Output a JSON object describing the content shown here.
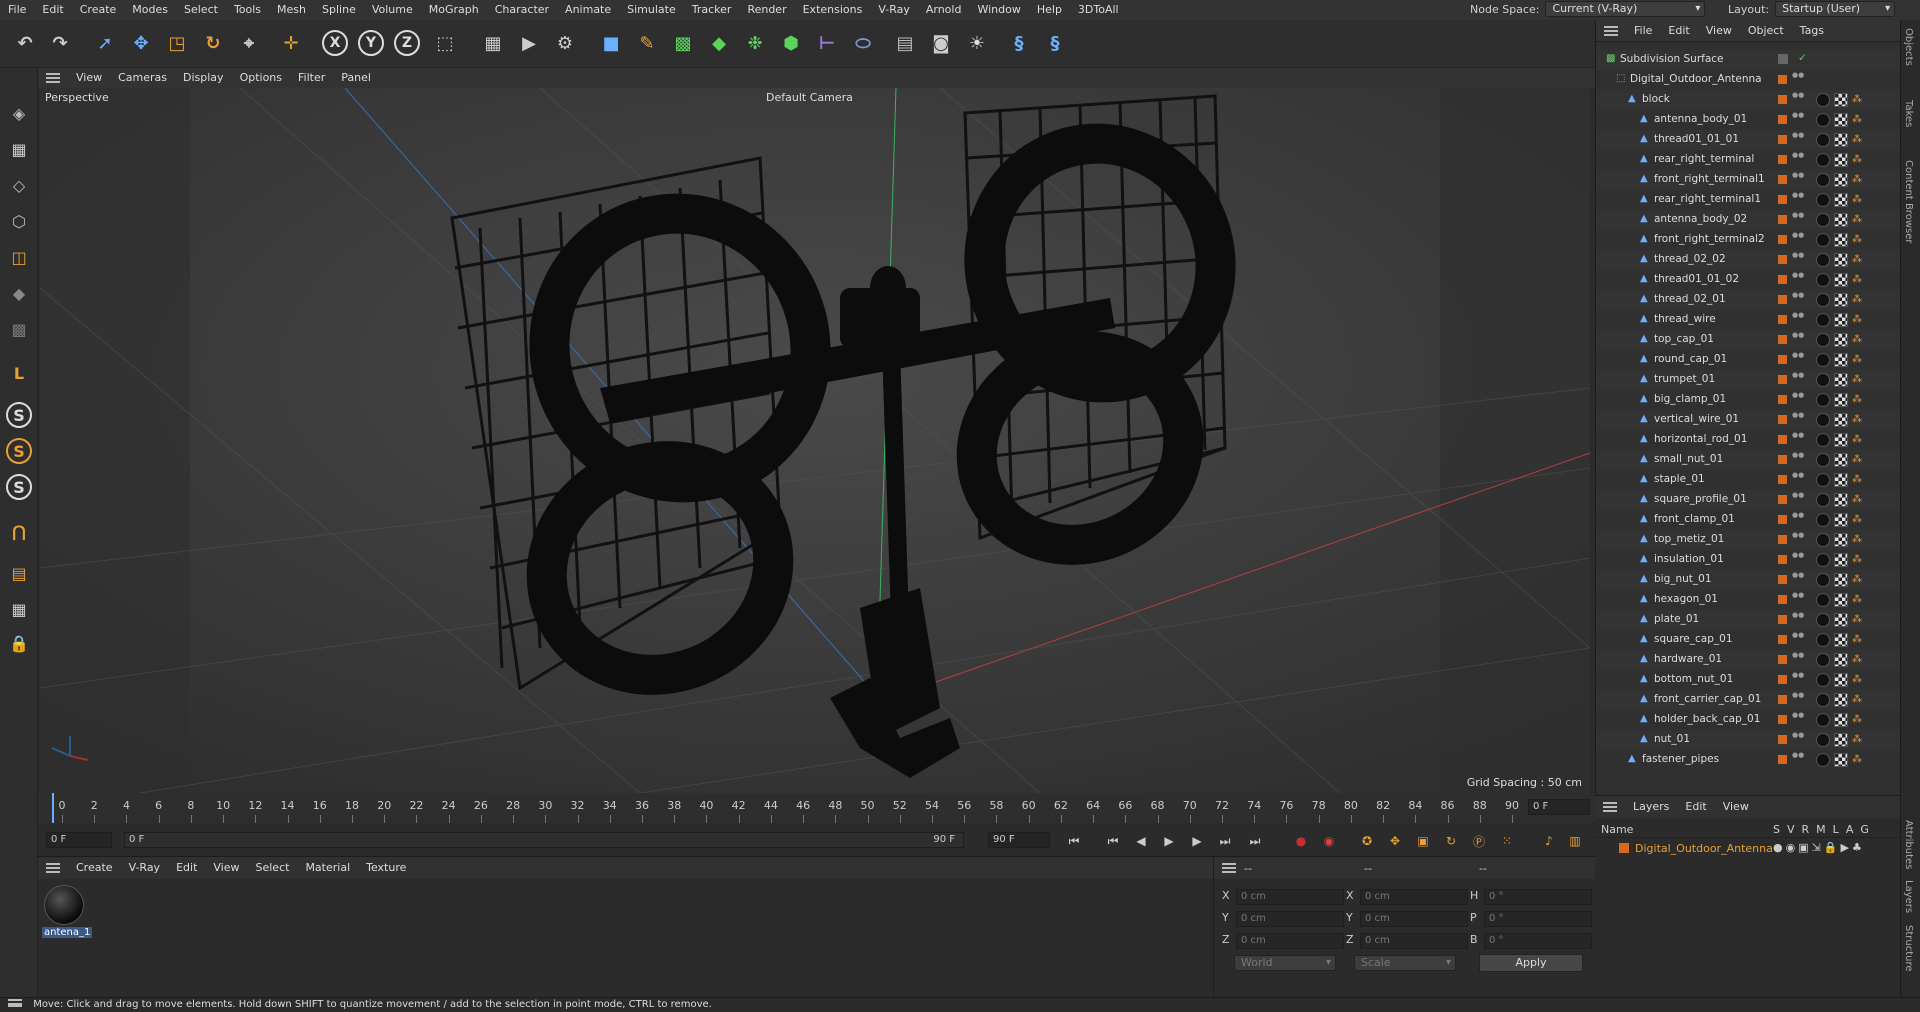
{
  "menubar": {
    "items": [
      "File",
      "Edit",
      "Create",
      "Modes",
      "Select",
      "Tools",
      "Mesh",
      "Spline",
      "Volume",
      "MoGraph",
      "Character",
      "Animate",
      "Simulate",
      "Tracker",
      "Render",
      "Extensions",
      "V-Ray",
      "Arnold",
      "Window",
      "Help",
      "3DToAll"
    ],
    "node_space_label": "Node Space:",
    "node_space_value": "Current (V-Ray)",
    "layout_label": "Layout:",
    "layout_value": "Startup (User)"
  },
  "toolbar": {
    "icons": [
      "undo-icon",
      "redo-icon",
      "live-select-icon",
      "move-icon",
      "scale-icon",
      "rotate-icon",
      "recent-tool-icon",
      "add-tool-icon",
      "x-axis-icon",
      "y-axis-icon",
      "z-axis-icon",
      "coordinate-system-icon",
      "render-region-icon",
      "render-view-icon",
      "render-settings-icon",
      "cube-icon",
      "pen-icon",
      "subdivision-icon",
      "extrude-icon",
      "cloner-icon",
      "mograph-icon",
      "bend-icon",
      "deformer-icon",
      "floor-icon",
      "camera-icon",
      "light-icon",
      "python-icon",
      "python2-icon"
    ],
    "axis_x": "X",
    "axis_y": "Y",
    "axis_z": "Z"
  },
  "leftbar": {
    "icons": [
      "model-mode-icon",
      "object-mode-icon",
      "texture-mode-icon",
      "points-mode-icon",
      "edges-mode-icon",
      "polygons-mode-icon",
      "uv-mode-icon",
      "axis-mode-icon",
      "snap-s1-icon",
      "snap-s2-icon",
      "snap-s3-icon",
      "magnet-icon",
      "workplane-icon",
      "grid-icon",
      "lock-icon"
    ]
  },
  "viewport": {
    "menu": [
      "View",
      "Cameras",
      "Display",
      "Options",
      "Filter",
      "Panel"
    ],
    "label": "Perspective",
    "camera": "Default Camera",
    "grid_spacing": "Grid Spacing : 50 cm"
  },
  "timeline": {
    "ticks": [
      "0",
      "2",
      "4",
      "6",
      "8",
      "10",
      "12",
      "14",
      "16",
      "18",
      "20",
      "22",
      "24",
      "26",
      "28",
      "30",
      "32",
      "34",
      "36",
      "38",
      "40",
      "42",
      "44",
      "46",
      "48",
      "50",
      "52",
      "54",
      "56",
      "58",
      "60",
      "62",
      "64",
      "66",
      "68",
      "70",
      "72",
      "74",
      "76",
      "78",
      "80",
      "82",
      "84",
      "86",
      "88",
      "90"
    ],
    "current_frame": "0 F",
    "start_frame": "0 F",
    "range_start": "0 F",
    "range_end": "90 F",
    "end_frame": "90 F"
  },
  "material_panel": {
    "menu": [
      "Create",
      "V-Ray",
      "Edit",
      "View",
      "Select",
      "Material",
      "Texture"
    ],
    "material_name": "antena_1"
  },
  "coords": {
    "col_headers": [
      "--",
      "--",
      "--"
    ],
    "rows": [
      {
        "a": "X",
        "av": "0 cm",
        "b": "X",
        "bv": "0 cm",
        "c": "H",
        "cv": "0 °"
      },
      {
        "a": "Y",
        "av": "0 cm",
        "b": "Y",
        "bv": "0 cm",
        "c": "P",
        "cv": "0 °"
      },
      {
        "a": "Z",
        "av": "0 cm",
        "b": "Z",
        "bv": "0 cm",
        "c": "B",
        "cv": "0 °"
      }
    ],
    "space": "World",
    "mode": "Scale",
    "apply": "Apply"
  },
  "objects": {
    "menu": [
      "File",
      "Edit",
      "View",
      "Object",
      "Tags"
    ],
    "items": [
      {
        "name": "Subdivision Surface",
        "depth": 0,
        "type": "subdiv"
      },
      {
        "name": "Digital_Outdoor_Antenna",
        "depth": 1,
        "type": "null"
      },
      {
        "name": "block",
        "depth": 2,
        "type": "poly"
      },
      {
        "name": "antenna_body_01",
        "depth": 3,
        "type": "poly"
      },
      {
        "name": "thread01_01_01",
        "depth": 3,
        "type": "poly"
      },
      {
        "name": "rear_right_terminal",
        "depth": 3,
        "type": "poly"
      },
      {
        "name": "front_right_terminal1",
        "depth": 3,
        "type": "poly"
      },
      {
        "name": "rear_right_terminal1",
        "depth": 3,
        "type": "poly"
      },
      {
        "name": "antenna_body_02",
        "depth": 3,
        "type": "poly"
      },
      {
        "name": "front_right_terminal2",
        "depth": 3,
        "type": "poly"
      },
      {
        "name": "thread_02_02",
        "depth": 3,
        "type": "poly"
      },
      {
        "name": "thread01_01_02",
        "depth": 3,
        "type": "poly"
      },
      {
        "name": "thread_02_01",
        "depth": 3,
        "type": "poly"
      },
      {
        "name": "thread_wire",
        "depth": 3,
        "type": "poly"
      },
      {
        "name": "top_cap_01",
        "depth": 3,
        "type": "poly"
      },
      {
        "name": "round_cap_01",
        "depth": 3,
        "type": "poly"
      },
      {
        "name": "trumpet_01",
        "depth": 3,
        "type": "poly"
      },
      {
        "name": "big_clamp_01",
        "depth": 3,
        "type": "poly"
      },
      {
        "name": "vertical_wire_01",
        "depth": 3,
        "type": "poly"
      },
      {
        "name": "horizontal_rod_01",
        "depth": 3,
        "type": "poly"
      },
      {
        "name": "small_nut_01",
        "depth": 3,
        "type": "poly"
      },
      {
        "name": "staple_01",
        "depth": 3,
        "type": "poly"
      },
      {
        "name": "square_profile_01",
        "depth": 3,
        "type": "poly"
      },
      {
        "name": "front_clamp_01",
        "depth": 3,
        "type": "poly"
      },
      {
        "name": "top_metiz_01",
        "depth": 3,
        "type": "poly"
      },
      {
        "name": "insulation_01",
        "depth": 3,
        "type": "poly"
      },
      {
        "name": "big_nut_01",
        "depth": 3,
        "type": "poly"
      },
      {
        "name": "hexagon_01",
        "depth": 3,
        "type": "poly"
      },
      {
        "name": "plate_01",
        "depth": 3,
        "type": "poly"
      },
      {
        "name": "square_cap_01",
        "depth": 3,
        "type": "poly"
      },
      {
        "name": "hardware_01",
        "depth": 3,
        "type": "poly"
      },
      {
        "name": "bottom_nut_01",
        "depth": 3,
        "type": "poly"
      },
      {
        "name": "front_carrier_cap_01",
        "depth": 3,
        "type": "poly"
      },
      {
        "name": "holder_back_cap_01",
        "depth": 3,
        "type": "poly"
      },
      {
        "name": "nut_01",
        "depth": 3,
        "type": "poly"
      },
      {
        "name": "fastener_pipes",
        "depth": 2,
        "type": "poly"
      }
    ]
  },
  "layers": {
    "menu": [
      "Layers",
      "Edit",
      "View"
    ],
    "name_header": "Name",
    "flags": [
      "S",
      "V",
      "R",
      "M",
      "L",
      "A",
      "G"
    ],
    "items": [
      "Digital_Outdoor_Antenna"
    ]
  },
  "vtabs": [
    "Objects",
    "Takes",
    "Content Browser",
    "Attributes",
    "Layers",
    "Structure"
  ],
  "status": "Move: Click and drag to move elements. Hold down SHIFT to quantize movement / add to the selection in point mode, CTRL to remove.",
  "colors": {
    "accent": "#e8a035",
    "swatch": "#d8681f",
    "tree_icon": "#6ab0ff"
  }
}
